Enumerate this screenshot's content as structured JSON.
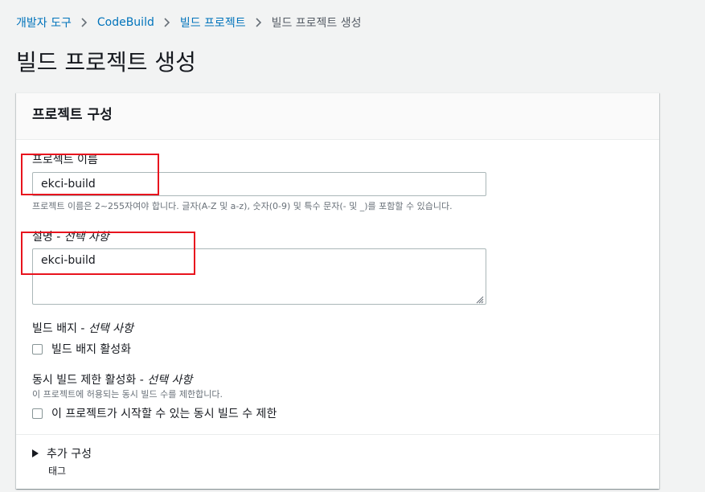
{
  "breadcrumb": {
    "items": [
      "개발자 도구",
      "CodeBuild",
      "빌드 프로젝트"
    ],
    "current": "빌드 프로젝트 생성"
  },
  "page": {
    "title": "빌드 프로젝트 생성"
  },
  "panel": {
    "title": "프로젝트 구성",
    "project_name": {
      "label": "프로젝트 이름",
      "value": "ekci-build",
      "hint": "프로젝트 이름은 2~255자여야 합니다. 글자(A-Z 및 a-z), 숫자(0-9) 및 특수 문자(- 및 _)를 포함할 수 있습니다."
    },
    "description": {
      "label": "설명 - ",
      "optional": "선택 사항",
      "value": "ekci-build"
    },
    "badge": {
      "label": "빌드 배지 - ",
      "optional": "선택 사항",
      "checkbox_label": "빌드 배지 활성화",
      "checked": false
    },
    "concurrency": {
      "label": "동시 빌드 제한 활성화 - ",
      "optional": "선택 사항",
      "hint": "이 프로젝트에 허용되는 동시 빌드 수를 제한합니다.",
      "checkbox_label": "이 프로젝트가 시작할 수 있는 동시 빌드 수 제한",
      "checked": false
    },
    "additional": {
      "label": "추가 구성",
      "sub_label": "태그"
    }
  },
  "colors": {
    "link": "#0073bb",
    "highlight": "#e8141e",
    "background": "#f2f3f3"
  }
}
